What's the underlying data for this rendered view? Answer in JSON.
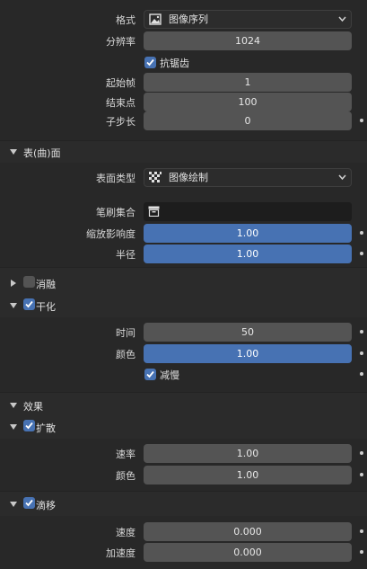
{
  "format": {
    "label": "格式",
    "value": "图像序列",
    "icon": "image-icon"
  },
  "resolution": {
    "label": "分辨率",
    "value": "1024"
  },
  "antialias": {
    "label": "抗锯齿",
    "checked": true
  },
  "start_frame": {
    "label": "起始帧",
    "value": "1"
  },
  "end_point": {
    "label": "结束点",
    "value": "100"
  },
  "substeps": {
    "label": "子步长",
    "value": "0"
  },
  "surface_section": {
    "title": "表(曲)面",
    "surface_type": {
      "label": "表面类型",
      "value": "图像绘制",
      "icon": "checker-icon"
    },
    "brush_collection": {
      "label": "笔刷集合",
      "value": ""
    },
    "falloff": {
      "label": "缩放影响度",
      "value": "1.00"
    },
    "radius": {
      "label": "半径",
      "value": "1.00"
    }
  },
  "dissolve": {
    "label": "消融",
    "checked": false
  },
  "dry": {
    "label": "干化",
    "checked": true,
    "time": {
      "label": "时间",
      "value": "50"
    },
    "color": {
      "label": "颜色",
      "value": "1.00"
    },
    "slow": {
      "label": "减慢",
      "checked": true
    }
  },
  "effects": {
    "title": "效果",
    "spread": {
      "label": "扩散",
      "checked": true,
      "rate": {
        "label": "速率",
        "value": "1.00"
      },
      "color": {
        "label": "颜色",
        "value": "1.00"
      }
    },
    "drip": {
      "label": "滴移",
      "checked": true,
      "speed": {
        "label": "速度",
        "value": "0.000"
      },
      "acceleration": {
        "label": "加速度",
        "value": "0.000"
      }
    }
  },
  "colors": {
    "accent": "#4772b3",
    "field": "#545454",
    "background": "#2b2b2b"
  }
}
